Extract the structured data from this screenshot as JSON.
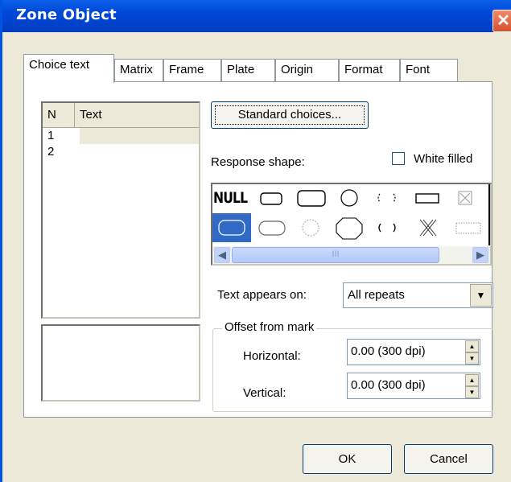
{
  "window": {
    "title": "Zone Object",
    "close_glyph": "✕"
  },
  "tabs": [
    {
      "label": "Choice text",
      "active": true
    },
    {
      "label": "Matrix",
      "active": false
    },
    {
      "label": "Frame",
      "active": false
    },
    {
      "label": "Plate",
      "active": false
    },
    {
      "label": "Origin",
      "active": false
    },
    {
      "label": "Format",
      "active": false
    },
    {
      "label": "Font",
      "active": false
    }
  ],
  "choice_list": {
    "columns": [
      "N",
      "Text"
    ],
    "rows": [
      {
        "n": "1",
        "text": ""
      },
      {
        "n": "2",
        "text": ""
      }
    ]
  },
  "standard_choices_button": {
    "label": "Standard choices..."
  },
  "response_shape": {
    "label": "Response shape:",
    "white_filled": {
      "label": "White filled",
      "checked": false
    },
    "row1": [
      "null",
      "rounded-rect-small",
      "rounded-rect-large",
      "circle",
      "dotted-brackets",
      "rectangle",
      "crossed-box"
    ],
    "row2": [
      "selected-rounded-rect",
      "rounded-oval",
      "dotted-circle",
      "octagon",
      "brackets",
      "x-cross",
      "dotted-rect"
    ],
    "null_text": "NULL",
    "scroll_thumb_grip": "III"
  },
  "text_appears_on": {
    "label": "Text appears on:",
    "value": "All repeats"
  },
  "offset_from_mark": {
    "title": "Offset from mark",
    "horizontal": {
      "label": "Horizontal:",
      "value": "0.00 (300 dpi)"
    },
    "vertical": {
      "label": "Vertical:",
      "value": "0.00 (300 dpi)"
    }
  },
  "buttons": {
    "ok": "OK",
    "cancel": "Cancel"
  },
  "colors": {
    "titlebar": "#0054e3",
    "dialog_bg": "#ece9d8",
    "selection": "#316ac5",
    "close": "#e0603a"
  }
}
